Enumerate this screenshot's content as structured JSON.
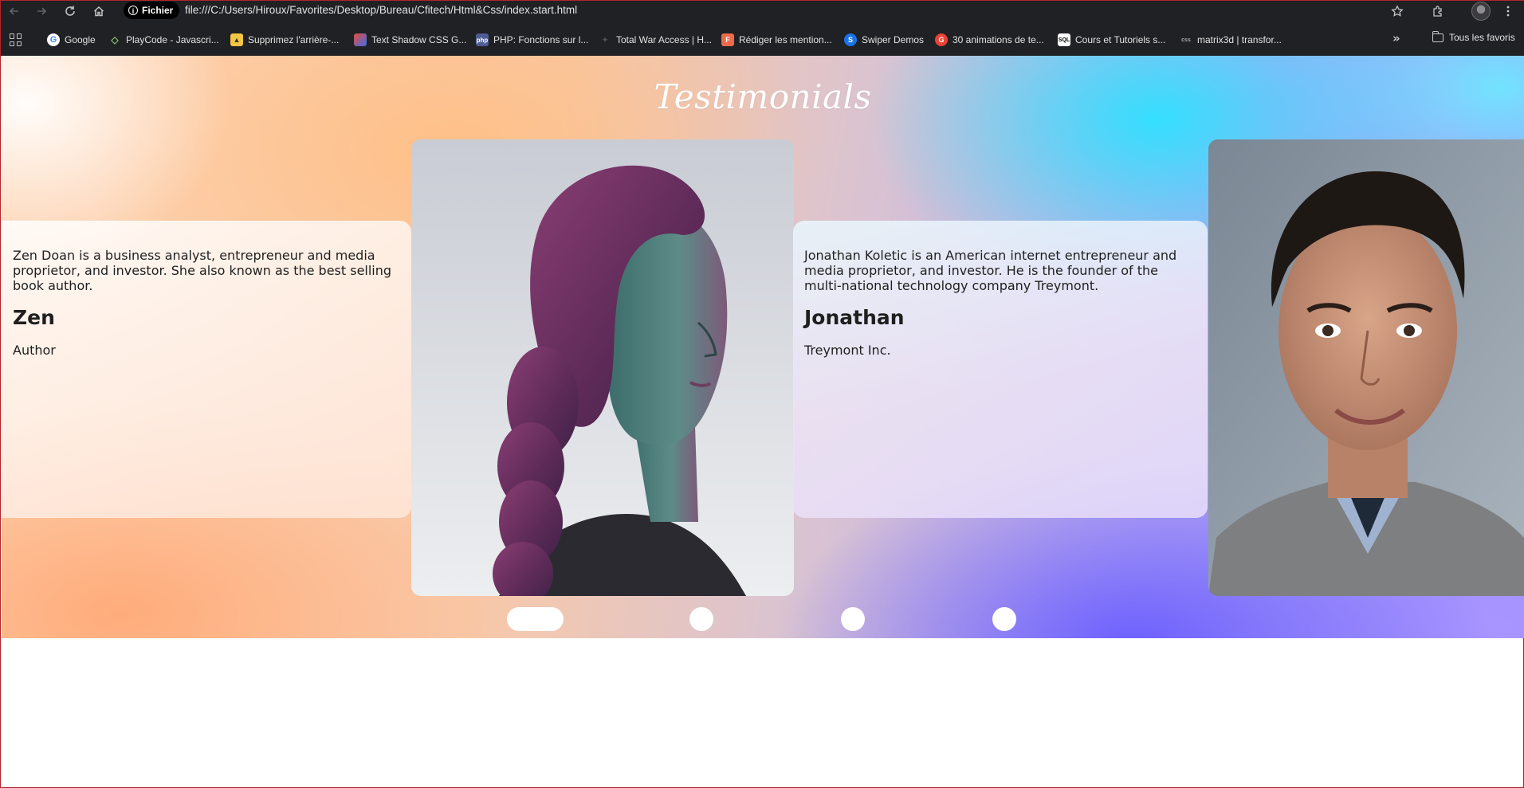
{
  "browser": {
    "site_chip": "Fichier",
    "url": "file:///C:/Users/Hiroux/Favorites/Desktop/Bureau/Cfitech/Html&Css/index.start.html",
    "bookmarks": [
      {
        "label": "Google",
        "icon": "google-icon"
      },
      {
        "label": "PlayCode - Javascri...",
        "icon": "playcode-icon"
      },
      {
        "label": "Supprimez l'arrière-...",
        "icon": "removebg-icon"
      },
      {
        "label": "Text Shadow CSS G...",
        "icon": "textshadow-icon"
      },
      {
        "label": "PHP: Fonctions sur l...",
        "icon": "php-icon"
      },
      {
        "label": "Total War Access | H...",
        "icon": "totalwar-icon"
      },
      {
        "label": "Rédiger les mention...",
        "icon": "mentions-icon"
      },
      {
        "label": "Swiper Demos",
        "icon": "swiper-icon"
      },
      {
        "label": "30 animations de te...",
        "icon": "animations-icon"
      },
      {
        "label": "Cours et Tutoriels s...",
        "icon": "sql-icon"
      },
      {
        "label": "matrix3d | transfor...",
        "icon": "css-icon"
      }
    ],
    "more_bookmarks": "»",
    "all_favorites": "Tous les favoris"
  },
  "page": {
    "title": "Testimonials",
    "testimonials": [
      {
        "quote": "Zen Doan is a business analyst, entrepreneur and media proprietor, and investor. She also known as the best selling book author.",
        "name": "Zen",
        "role": "Author"
      },
      {
        "quote": "Jonathan Koletic is an American internet entrepreneur and media proprietor, and investor. He is the founder of the multi-national technology company Treymont.",
        "name": "Jonathan",
        "role": "Treymont Inc."
      }
    ],
    "pagination": {
      "total": 4,
      "active": 1
    }
  }
}
